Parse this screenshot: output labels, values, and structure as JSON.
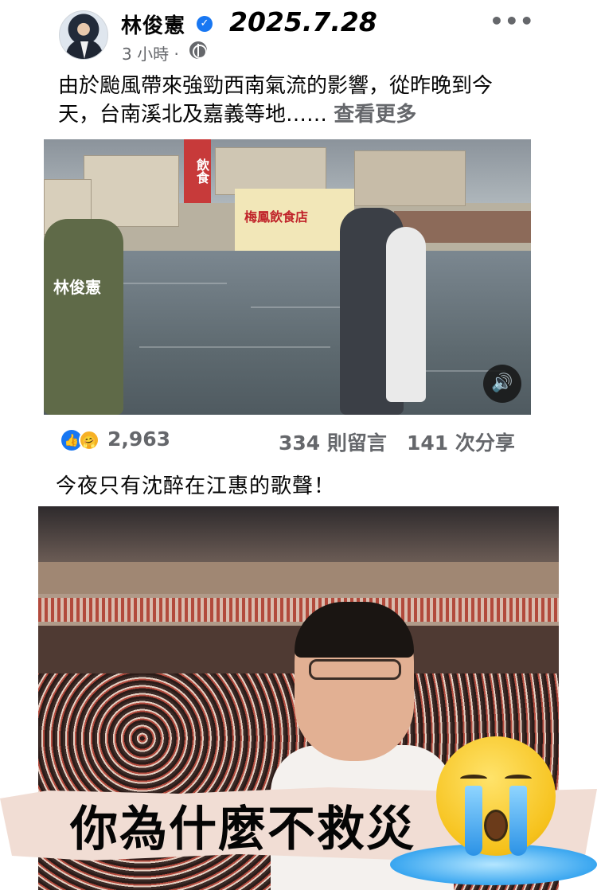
{
  "post": {
    "author": "林俊憲",
    "verified_icon": "verified-badge-icon",
    "date_overlay": "2025.7.28",
    "time": "3 小時 ·",
    "audience_icon": "globe-icon",
    "more_icon": "more-dots-icon",
    "more_text": "•••",
    "text": "由於颱風帶來強勁西南氣流的影響，從昨晚到今天，台南溪北及嘉義等地……",
    "see_more": "查看更多",
    "photo_labels": {
      "vest_back": "林俊憲",
      "shop_sign": "梅鳳飲食店",
      "banner": "飲食"
    },
    "sound_icon": "speaker-icon",
    "sound_glyph": "🔊",
    "reactions": {
      "like_glyph": "👍",
      "care_glyph": "🤗",
      "count": "2,963"
    },
    "comments": "334 則留言",
    "shares": "141 次分享"
  },
  "second_panel": {
    "caption": "今夜只有沈醉在江惠的歌聲！",
    "banner_text": "你為什麼不救災",
    "emoji": "crying-face-emoji"
  }
}
